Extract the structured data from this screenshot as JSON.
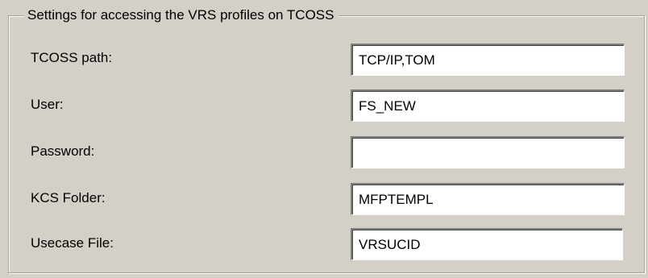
{
  "group": {
    "title": "Settings for accessing the VRS profiles on TCOSS"
  },
  "fields": [
    {
      "label": "TCOSS path:",
      "value": "TCP/IP,TOM"
    },
    {
      "label": "User:",
      "value": "FS_NEW"
    },
    {
      "label": "Password:",
      "value": ""
    },
    {
      "label": "KCS Folder:",
      "value": "MFPTEMPL"
    },
    {
      "label": "Usecase File:",
      "value": "VRSUCID"
    }
  ],
  "colors": {
    "background": "#d4d0c8",
    "input_background": "#ffffff",
    "groupbox_border": "#a6a39b"
  }
}
